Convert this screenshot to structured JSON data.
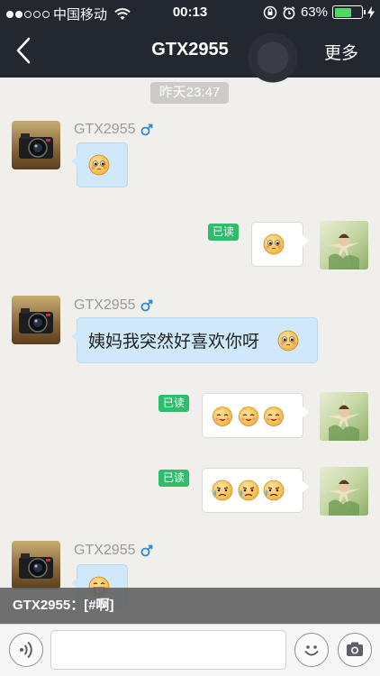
{
  "status_bar": {
    "carrier": "中国移动",
    "time": "00:13",
    "battery_percent": "63%",
    "battery_level": 0.63
  },
  "nav": {
    "title": "GTX2955",
    "more_label": "更多"
  },
  "chat": {
    "timestamp": "昨天23:47",
    "sender_name": "GTX2955",
    "read_label": "已读",
    "text_message": "姨妈我突然好喜欢你呀"
  },
  "preview": {
    "text": "GTX2955：[#啊]"
  },
  "colors": {
    "nav_bg": "#23272f",
    "chat_bg": "#f1efec",
    "incoming_bubble": "#cfe9fa",
    "read_badge": "#2fbc6b",
    "male_icon": "#2b8ad8"
  }
}
